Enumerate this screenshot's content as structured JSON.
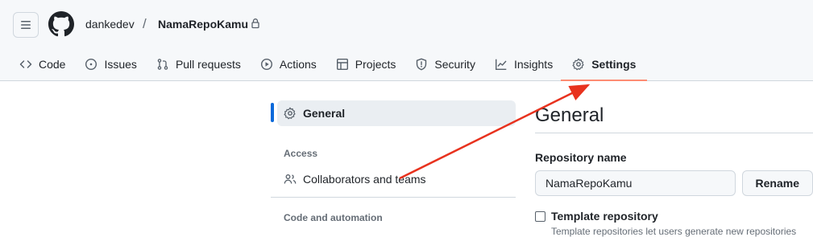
{
  "header": {
    "owner": "dankedev",
    "separator": "/",
    "repo_name": "NamaRepoKamu"
  },
  "tabs": [
    {
      "label": "Code",
      "icon": "code-icon"
    },
    {
      "label": "Issues",
      "icon": "issue-opened-icon"
    },
    {
      "label": "Pull requests",
      "icon": "git-pull-request-icon"
    },
    {
      "label": "Actions",
      "icon": "play-icon"
    },
    {
      "label": "Projects",
      "icon": "table-icon"
    },
    {
      "label": "Security",
      "icon": "shield-icon"
    },
    {
      "label": "Insights",
      "icon": "graph-icon"
    },
    {
      "label": "Settings",
      "icon": "gear-icon",
      "selected": true
    }
  ],
  "sidebar": {
    "general": "General",
    "access_heading": "Access",
    "collaborators": "Collaborators and teams",
    "code_heading": "Code and automation"
  },
  "main": {
    "title": "General",
    "repo_name_label": "Repository name",
    "repo_name_value": "NamaRepoKamu",
    "rename_label": "Rename",
    "template_label": "Template repository",
    "template_desc": "Template repositories let users generate new repositories"
  },
  "colors": {
    "accent_blue": "#0969da",
    "tab_underline": "#fd8c73",
    "annotation_arrow": "#e8321e"
  }
}
